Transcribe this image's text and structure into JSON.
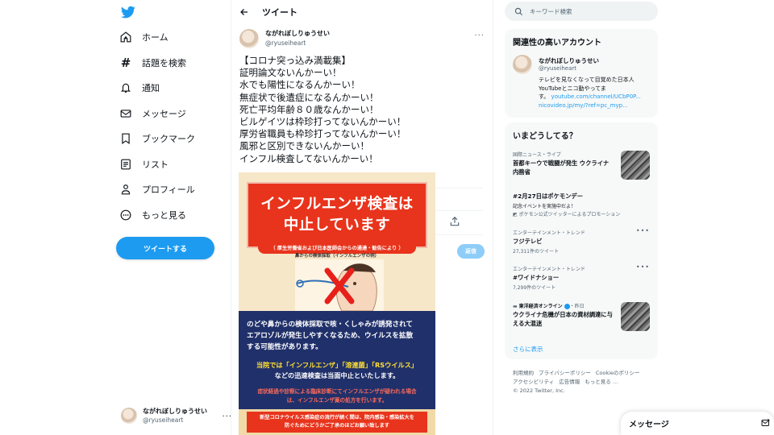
{
  "nav": {
    "items": [
      {
        "label": "ホーム"
      },
      {
        "label": "話題を検索"
      },
      {
        "label": "通知"
      },
      {
        "label": "メッセージ"
      },
      {
        "label": "ブックマーク"
      },
      {
        "label": "リスト"
      },
      {
        "label": "プロフィール"
      },
      {
        "label": "もっと見る"
      }
    ],
    "tweet_button": "ツイートする",
    "account": {
      "name": "ながれぼしりゅうせい",
      "handle": "@ryuseiheart",
      "more": "..."
    }
  },
  "main": {
    "header_title": "ツイート",
    "author": {
      "name": "ながれぼしりゅうせい",
      "handle": "@ryuseiheart"
    },
    "tweet_more": "...",
    "tweet_lines": [
      "【コロナ突っ込み満載集】",
      "証明論文ないんかーい！",
      "水でも陽性になるんかーい！",
      "無症状で後遺症になるんかーい！",
      "死亡平均年齢８０歳なんかーい！",
      "ビルゲイツは枠珍打ってないんかーい！",
      "厚労省職員も枠珍打ってないんかーい！",
      "風邪と区別できないんかーい！",
      "インフル検査してないんかーい！"
    ],
    "reply_button": "返信",
    "poster": {
      "headline": [
        "インフルエンザ検査は",
        "中止しています"
      ],
      "pill": "（ 厚生労働省および日本医師会からの通達・勧告により ）",
      "caption": "鼻からの検体採取（インフルエンザの例）",
      "para1": [
        "のどや鼻からの検体採取で咳・くしゃみが誘発されて",
        "エアロゾルが発生しやすくなるため、ウイルスを拡散",
        "する可能性があります。"
      ],
      "para2_line1": "当院では「インフルエンザ」「溶連菌」「RSウイルス」",
      "para2_line2": "などの迅速検査は当面中止といたします。",
      "para3": [
        "症状経過や診察による臨床診断にてインフルエンザが疑われる場合",
        "は、インフルエンザ薬の処方を行います。"
      ],
      "bottom": [
        "新型コロナウイルス感染症の流行が続く間は、院内感染・感染拡大を",
        "防ぐためにどうかご了承のほどお願い致します"
      ]
    }
  },
  "right": {
    "search_placeholder": "キーワード検索",
    "related_title": "関連性の高いアカウント",
    "related": {
      "name": "ながれぼしりゅうせい",
      "handle": "@ryuseiheart",
      "bio_lines": [
        "テレビを見なくなって目覚めた日本人",
        "YouTubeとニコ動やってま",
        "す。"
      ],
      "link1": "youtube.com/channel/UCbP0P...",
      "link2": "nicovideo.jp/my/?ref=pc_myp..."
    },
    "trends_title": "いまどうしてる？",
    "trends": [
      {
        "meta": "国際ニュース・ライブ",
        "title": "首都キーウで戦闘が発生 ウクライナ",
        "title2": "内務省"
      },
      {
        "meta": "",
        "title": "#2月27日はポケモンデー",
        "sub": "記念イベントを実施中だよ！",
        "sub2": "ポケモン公式ツイッターによるプロモーション"
      },
      {
        "meta": "エンターテインメント・トレンド",
        "title": "フジテレビ",
        "sub": "27,311件のツイート"
      },
      {
        "meta": "エンターテインメント・トレンド",
        "title": "#ワイドナショー",
        "sub": "7,299件のツイート"
      },
      {
        "meta": "東洋経済オンライン",
        "meta_time": "・昨日",
        "title": "ウクライナ危機が日本の資材調達に与",
        "title2": "える大混迷"
      }
    ],
    "show_more": "さらに表示",
    "footer": [
      "利用規約",
      "プライバシーポリシー",
      "Cookieのポリシー",
      "アクセシビリティ",
      "広告情報",
      "もっと見る …",
      "© 2022 Twitter, Inc."
    ]
  },
  "message_drawer": {
    "title": "メッセージ"
  },
  "colors": {
    "accent": "#1d9bf0",
    "text": "#0f1419",
    "muted": "#536471",
    "panel": "#f7f9f9"
  }
}
